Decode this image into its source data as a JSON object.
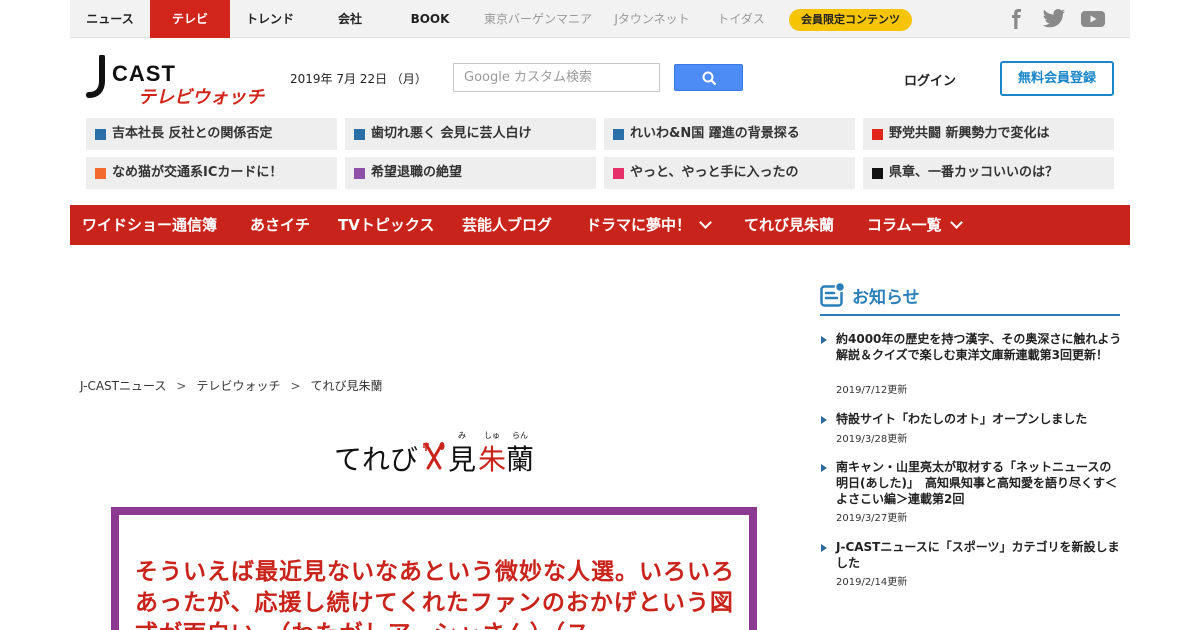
{
  "topnav": {
    "items": [
      {
        "label": "ニュース"
      },
      {
        "label": "テレビ"
      },
      {
        "label": "トレンド"
      },
      {
        "label": "会社"
      },
      {
        "label": "BOOK"
      },
      {
        "label": "東京バーゲンマニア"
      },
      {
        "label": "Jタウンネット"
      },
      {
        "label": "トイダス"
      }
    ],
    "members_label": "会員限定コンテンツ",
    "social_icons": [
      "facebook-icon",
      "twitter-icon",
      "youtube-icon"
    ]
  },
  "header": {
    "logo_main": "J-CAST",
    "logo_sub": "テレビウォッチ",
    "date": "2019年 7月 22日 （月）",
    "search_placeholder": "Google カスタム検索",
    "login_label": "ログイン",
    "register_label": "無料会員登録"
  },
  "topics": [
    {
      "label": "吉本社長 反社との関係否定",
      "color": "#2a6fa8"
    },
    {
      "label": "歯切れ悪く 会見に芸人白け",
      "color": "#2a6fa8"
    },
    {
      "label": "れいわ&N国 躍進の背景探る",
      "color": "#2a6fa8"
    },
    {
      "label": "野党共闘 新興勢力で変化は",
      "color": "#e0261c"
    },
    {
      "label": "なめ猫が交通系ICカードに！",
      "color": "#f26a2e"
    },
    {
      "label": "希望退職の絶望",
      "color": "#8e4fa8"
    },
    {
      "label": "やっと、やっと手に入ったの",
      "color": "#e5306a"
    },
    {
      "label": "県章、一番カッコいいのは？",
      "color": "#111111"
    }
  ],
  "categories": [
    {
      "label": "ワイドショー通信簿"
    },
    {
      "label": "あさイチ"
    },
    {
      "label": "TVトピックス"
    },
    {
      "label": "芸能人ブログ"
    },
    {
      "label": "ドラマに夢中！"
    },
    {
      "label": "てれび見朱蘭"
    },
    {
      "label": "コラム一覧"
    }
  ],
  "breadcrumb": [
    "J-CASTニュース",
    "テレビウォッチ",
    "てれび見朱蘭"
  ],
  "series": {
    "part1": "てれび",
    "part2": "見",
    "part3": "朱",
    "part4": "蘭",
    "ruby": [
      "み",
      "しゅ",
      "らん"
    ]
  },
  "article": {
    "lead": "そういえば最近見ないなあという微妙な人選。いろいろあったが、応援し続けてくれたファンのおかげという図式が面白い。（わたがしアーシャさん）（ス"
  },
  "sidebar": {
    "heading": "お知らせ",
    "news": [
      {
        "title": "約4000年の歴史を持つ漢字、その奥深さに触れよう　解説＆クイズで楽しむ東洋文庫新連載第3回更新！",
        "date": "2019/7/12更新"
      },
      {
        "title": "特設サイト「わたしのオト」オープンしました",
        "date": "2019/3/28更新"
      },
      {
        "title": "南キャン・山里亮太が取材する「ネットニュースの明日(あした)」　高知県知事と高知愛を語り尽くす＜よさこい編＞連載第2回",
        "date": "2019/3/27更新"
      },
      {
        "title": "J-CASTニュースに「スポーツ」カテゴリを新設しました",
        "date": "2019/2/14更新"
      }
    ]
  },
  "colors": {
    "brand_red": "#c9241b",
    "accent_blue": "#2b7fb8",
    "frame_purple": "#8b3a8f",
    "pill_yellow": "#f6c400"
  }
}
